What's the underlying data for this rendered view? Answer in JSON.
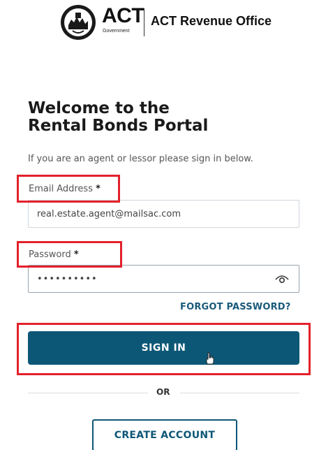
{
  "header": {
    "logo_text": "ACT",
    "logo_subtext": "Government",
    "office_name": "ACT Revenue Office"
  },
  "title_line1": "Welcome to the",
  "title_line2": "Rental Bonds Portal",
  "intro": "If you are an agent or lessor please sign in below.",
  "email": {
    "label": "Email Address",
    "required_mark": "*",
    "value": "real.estate.agent@mailsac.com"
  },
  "password": {
    "label": "Password",
    "required_mark": "*",
    "value": "••••••••••",
    "toggle_icon": "eye-icon"
  },
  "forgot_password": "FORGOT PASSWORD?",
  "sign_in": "SIGN IN",
  "or": "OR",
  "create_account": "CREATE ACCOUNT",
  "colors": {
    "primary": "#0d5776",
    "highlight": "#e3212b"
  }
}
